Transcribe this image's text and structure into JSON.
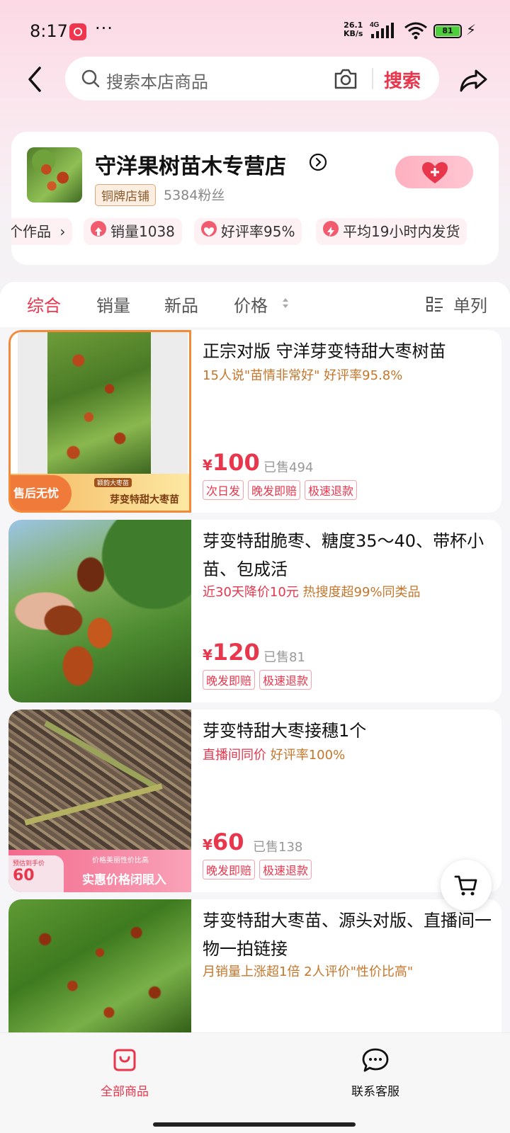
{
  "status_bar": {
    "time": "8:17",
    "net_speed_value": "26.1",
    "net_speed_unit": "KB/s",
    "network_type": "4G",
    "battery": "81"
  },
  "header": {
    "search_placeholder": "搜索本店商品",
    "search_button": "搜索"
  },
  "store": {
    "name": "守洋果树苗木专营店",
    "tier": "铜牌店铺",
    "fans": "5384粉丝",
    "chips": [
      {
        "label": "个作品",
        "icon": "chevron-right"
      },
      {
        "label": "销量1038",
        "icon": "up-arrow"
      },
      {
        "label": "好评率95%",
        "icon": "heart"
      },
      {
        "label": "平均19小时内发货",
        "icon": "lightning"
      }
    ]
  },
  "tabs": {
    "items": [
      "综合",
      "销量",
      "新品",
      "价格"
    ],
    "view_label": "单列"
  },
  "products": [
    {
      "title": "正宗对版 守洋芽变特甜大枣树苗",
      "hint": "15人说\"苗情非常好\"  好评率95.8%",
      "yen": "¥",
      "price": "100",
      "sold": "已售494",
      "tags": [
        "次日发",
        "晚发即赔",
        "极速退款"
      ],
      "thumb_overlay": {
        "left": "售后无忧",
        "top": "颖韵大枣苗",
        "bottom": "芽变特甜大枣苗"
      }
    },
    {
      "title": "芽变特甜脆枣、糖度35～40、带杯小苗、包成活",
      "hint_red": "近30天降价10元",
      "hint": "  热搜度超99%同类品",
      "yen": "¥",
      "price": "120",
      "sold": "已售81",
      "tags": [
        "晚发即赔",
        "极速退款"
      ]
    },
    {
      "title": "芽变特甜大枣接穗1个",
      "hint_red": "直播间同价",
      "hint": "  好评率100%",
      "yen": "¥",
      "price": "60",
      "sold": "已售138",
      "tags": [
        "晚发即赔",
        "极速退款"
      ],
      "thumb_overlay": {
        "small": "预估到手价",
        "price": "60",
        "top": "价格美丽性价比高",
        "bottom": "实惠价格闭眼入"
      }
    },
    {
      "title": "芽变特甜大枣苗、源头对版、直播间一物一拍链接",
      "hint": "月销量上涨超1倍  2人评价\"性价比高\""
    }
  ],
  "bottom_nav": {
    "all_products": "全部商品",
    "customer_service": "联系客服"
  },
  "colors": {
    "accent": "#e8364d",
    "hint": "#c4762b"
  }
}
